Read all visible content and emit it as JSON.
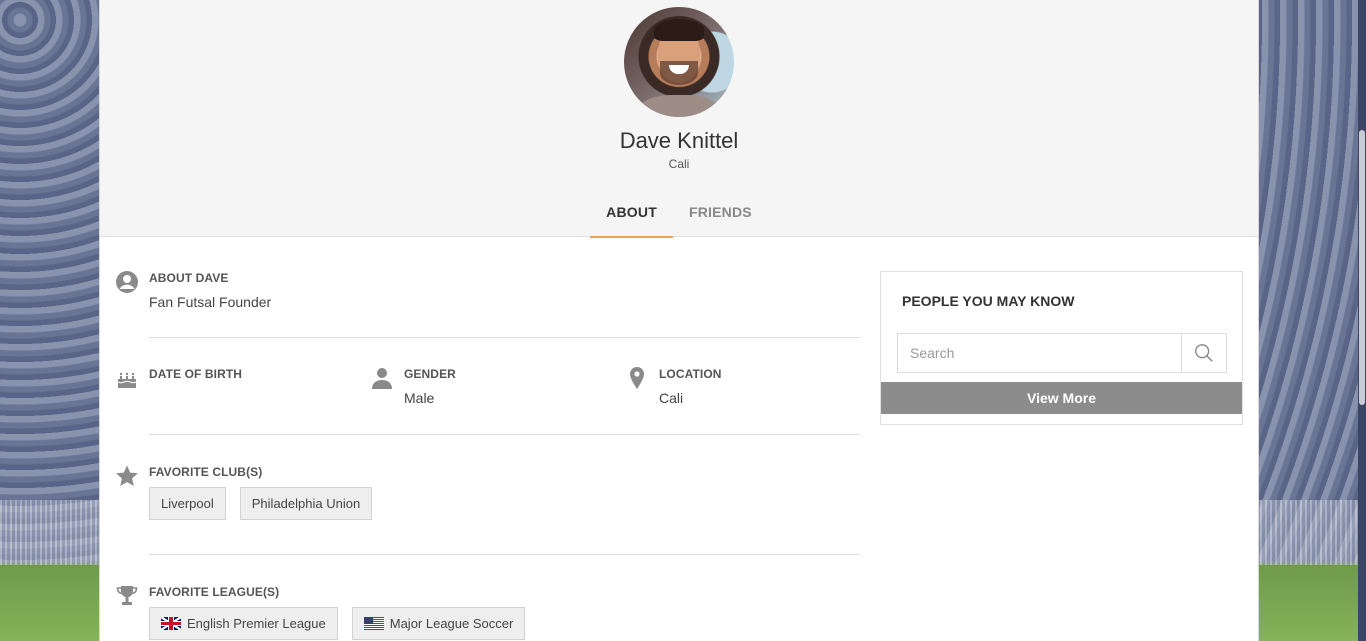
{
  "profile": {
    "name": "Dave Knittel",
    "location": "Cali"
  },
  "tabs": [
    {
      "label": "ABOUT",
      "active": true
    },
    {
      "label": "FRIENDS",
      "active": false
    }
  ],
  "about": {
    "label": "ABOUT DAVE",
    "value": "Fan Futsal Founder"
  },
  "details": {
    "dob_label": "DATE OF BIRTH",
    "dob_value": "",
    "gender_label": "GENDER",
    "gender_value": "Male",
    "location_label": "LOCATION",
    "location_value": "Cali"
  },
  "favorite_clubs": {
    "label": "FAVORITE CLUB(S)",
    "items": [
      "Liverpool",
      "Philadelphia Union"
    ]
  },
  "favorite_leagues": {
    "label": "FAVORITE LEAGUE(S)",
    "items": [
      {
        "label": "English Premier League",
        "flag": "uk-flag"
      },
      {
        "label": "Major League Soccer",
        "flag": "us-flag"
      }
    ]
  },
  "sidebar": {
    "title": "PEOPLE YOU MAY KNOW",
    "search_placeholder": "Search",
    "view_more_label": "View More"
  },
  "colors": {
    "tab_accent": "#f0a24e",
    "icon_gray": "#8a8a8a",
    "button_gray": "#8c8c8c"
  }
}
